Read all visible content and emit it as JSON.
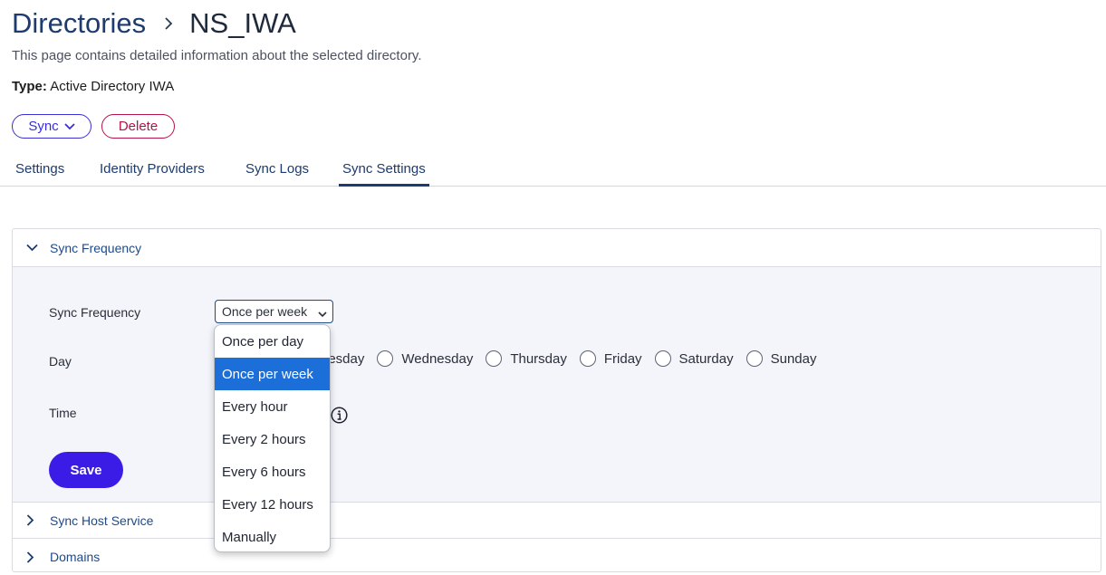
{
  "breadcrumb": {
    "parent": "Directories",
    "current": "NS_IWA"
  },
  "subtitle": "This page contains detailed information about the selected directory.",
  "type": {
    "label": "Type:",
    "value": "Active Directory IWA"
  },
  "actions": {
    "sync": "Sync",
    "delete": "Delete"
  },
  "tabs": [
    "Settings",
    "Identity Providers",
    "Sync Logs",
    "Sync Settings"
  ],
  "active_tab": "Sync Settings",
  "sync_frequency_section": {
    "title": "Sync Frequency",
    "frequency_label": "Sync Frequency",
    "frequency_value": "Once per week",
    "day_label": "Day",
    "days_visible": [
      "uesday",
      "Wednesday",
      "Thursday",
      "Friday",
      "Saturday",
      "Sunday"
    ],
    "time_label": "Time",
    "save": "Save"
  },
  "other_sections": [
    "Sync Host Service",
    "Domains"
  ],
  "dropdown": {
    "options": [
      "Once per day",
      "Once per week",
      "Every hour",
      "Every 2 hours",
      "Every 6 hours",
      "Every 12 hours",
      "Manually"
    ],
    "selected": "Once per week"
  },
  "colors": {
    "primary": "#3b1ce6",
    "danger": "#b3124a",
    "link": "#1d4a8a",
    "selected_option": "#1c6fd9"
  }
}
